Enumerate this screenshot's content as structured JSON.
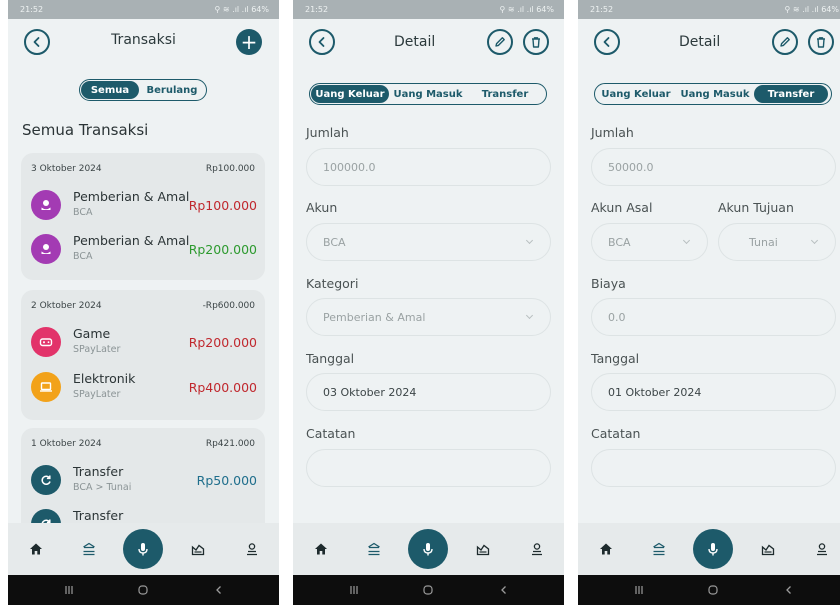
{
  "status": {
    "time": "21:52",
    "right": "⚲ ≋ .ıl .ıl 64%"
  },
  "screen1": {
    "title": "Transaksi",
    "add_label": "+",
    "tabs": [
      "Semua",
      "Berulang"
    ],
    "section": "Semua Transaksi",
    "groups": [
      {
        "date": "3 Oktober 2024",
        "total": "Rp100.000",
        "items": [
          {
            "name": "Pemberian & Amal",
            "sub": "BCA",
            "amount": "Rp100.000",
            "tone": "red",
            "icon": "charity-icon",
            "color": "#a33bb3"
          },
          {
            "name": "Pemberian & Amal",
            "sub": "BCA",
            "amount": "Rp200.000",
            "tone": "green",
            "icon": "charity-icon",
            "color": "#a33bb3"
          }
        ]
      },
      {
        "date": "2 Oktober 2024",
        "total": "-Rp600.000",
        "items": [
          {
            "name": "Game",
            "sub": "SPayLater",
            "amount": "Rp200.000",
            "tone": "red",
            "icon": "gamepad-icon",
            "color": "#e2336a"
          },
          {
            "name": "Elektronik",
            "sub": "SPayLater",
            "amount": "Rp400.000",
            "tone": "red",
            "icon": "laptop-icon",
            "color": "#f2a21a"
          }
        ]
      },
      {
        "date": "1 Oktober 2024",
        "total": "Rp421.000",
        "items": [
          {
            "name": "Transfer",
            "sub": "BCA > Tunai",
            "amount": "Rp50.000",
            "tone": "blue",
            "icon": "refresh-icon",
            "color": "#1d5a6a"
          },
          {
            "name": "Transfer",
            "sub": "",
            "amount": "",
            "tone": "blue",
            "icon": "refresh-icon",
            "color": "#1d5a6a"
          }
        ]
      }
    ]
  },
  "screen2": {
    "title": "Detail",
    "tabs": [
      "Uang Keluar",
      "Uang Masuk",
      "Transfer"
    ],
    "jumlah_label": "Jumlah",
    "jumlah_value": "100000.0",
    "akun_label": "Akun",
    "akun_value": "BCA",
    "kategori_label": "Kategori",
    "kategori_value": "Pemberian & Amal",
    "tanggal_label": "Tanggal",
    "tanggal_value": "03 Oktober 2024",
    "catatan_label": "Catatan",
    "catatan_value": ""
  },
  "screen3": {
    "title": "Detail",
    "tabs": [
      "Uang Keluar",
      "Uang Masuk",
      "Transfer"
    ],
    "jumlah_label": "Jumlah",
    "jumlah_value": "50000.0",
    "akun_asal_label": "Akun Asal",
    "akun_asal_value": "BCA",
    "akun_tujuan_label": "Akun Tujuan",
    "akun_tujuan_value": "Tunai",
    "biaya_label": "Biaya",
    "biaya_value": "0.0",
    "tanggal_label": "Tanggal",
    "tanggal_value": "01 Oktober 2024",
    "catatan_label": "Catatan",
    "catatan_value": ""
  },
  "colors": {
    "primary": "#1d5a6a",
    "expense": "#c0282e",
    "income": "#2d9a2f",
    "transfer": "#1f6e8c"
  }
}
